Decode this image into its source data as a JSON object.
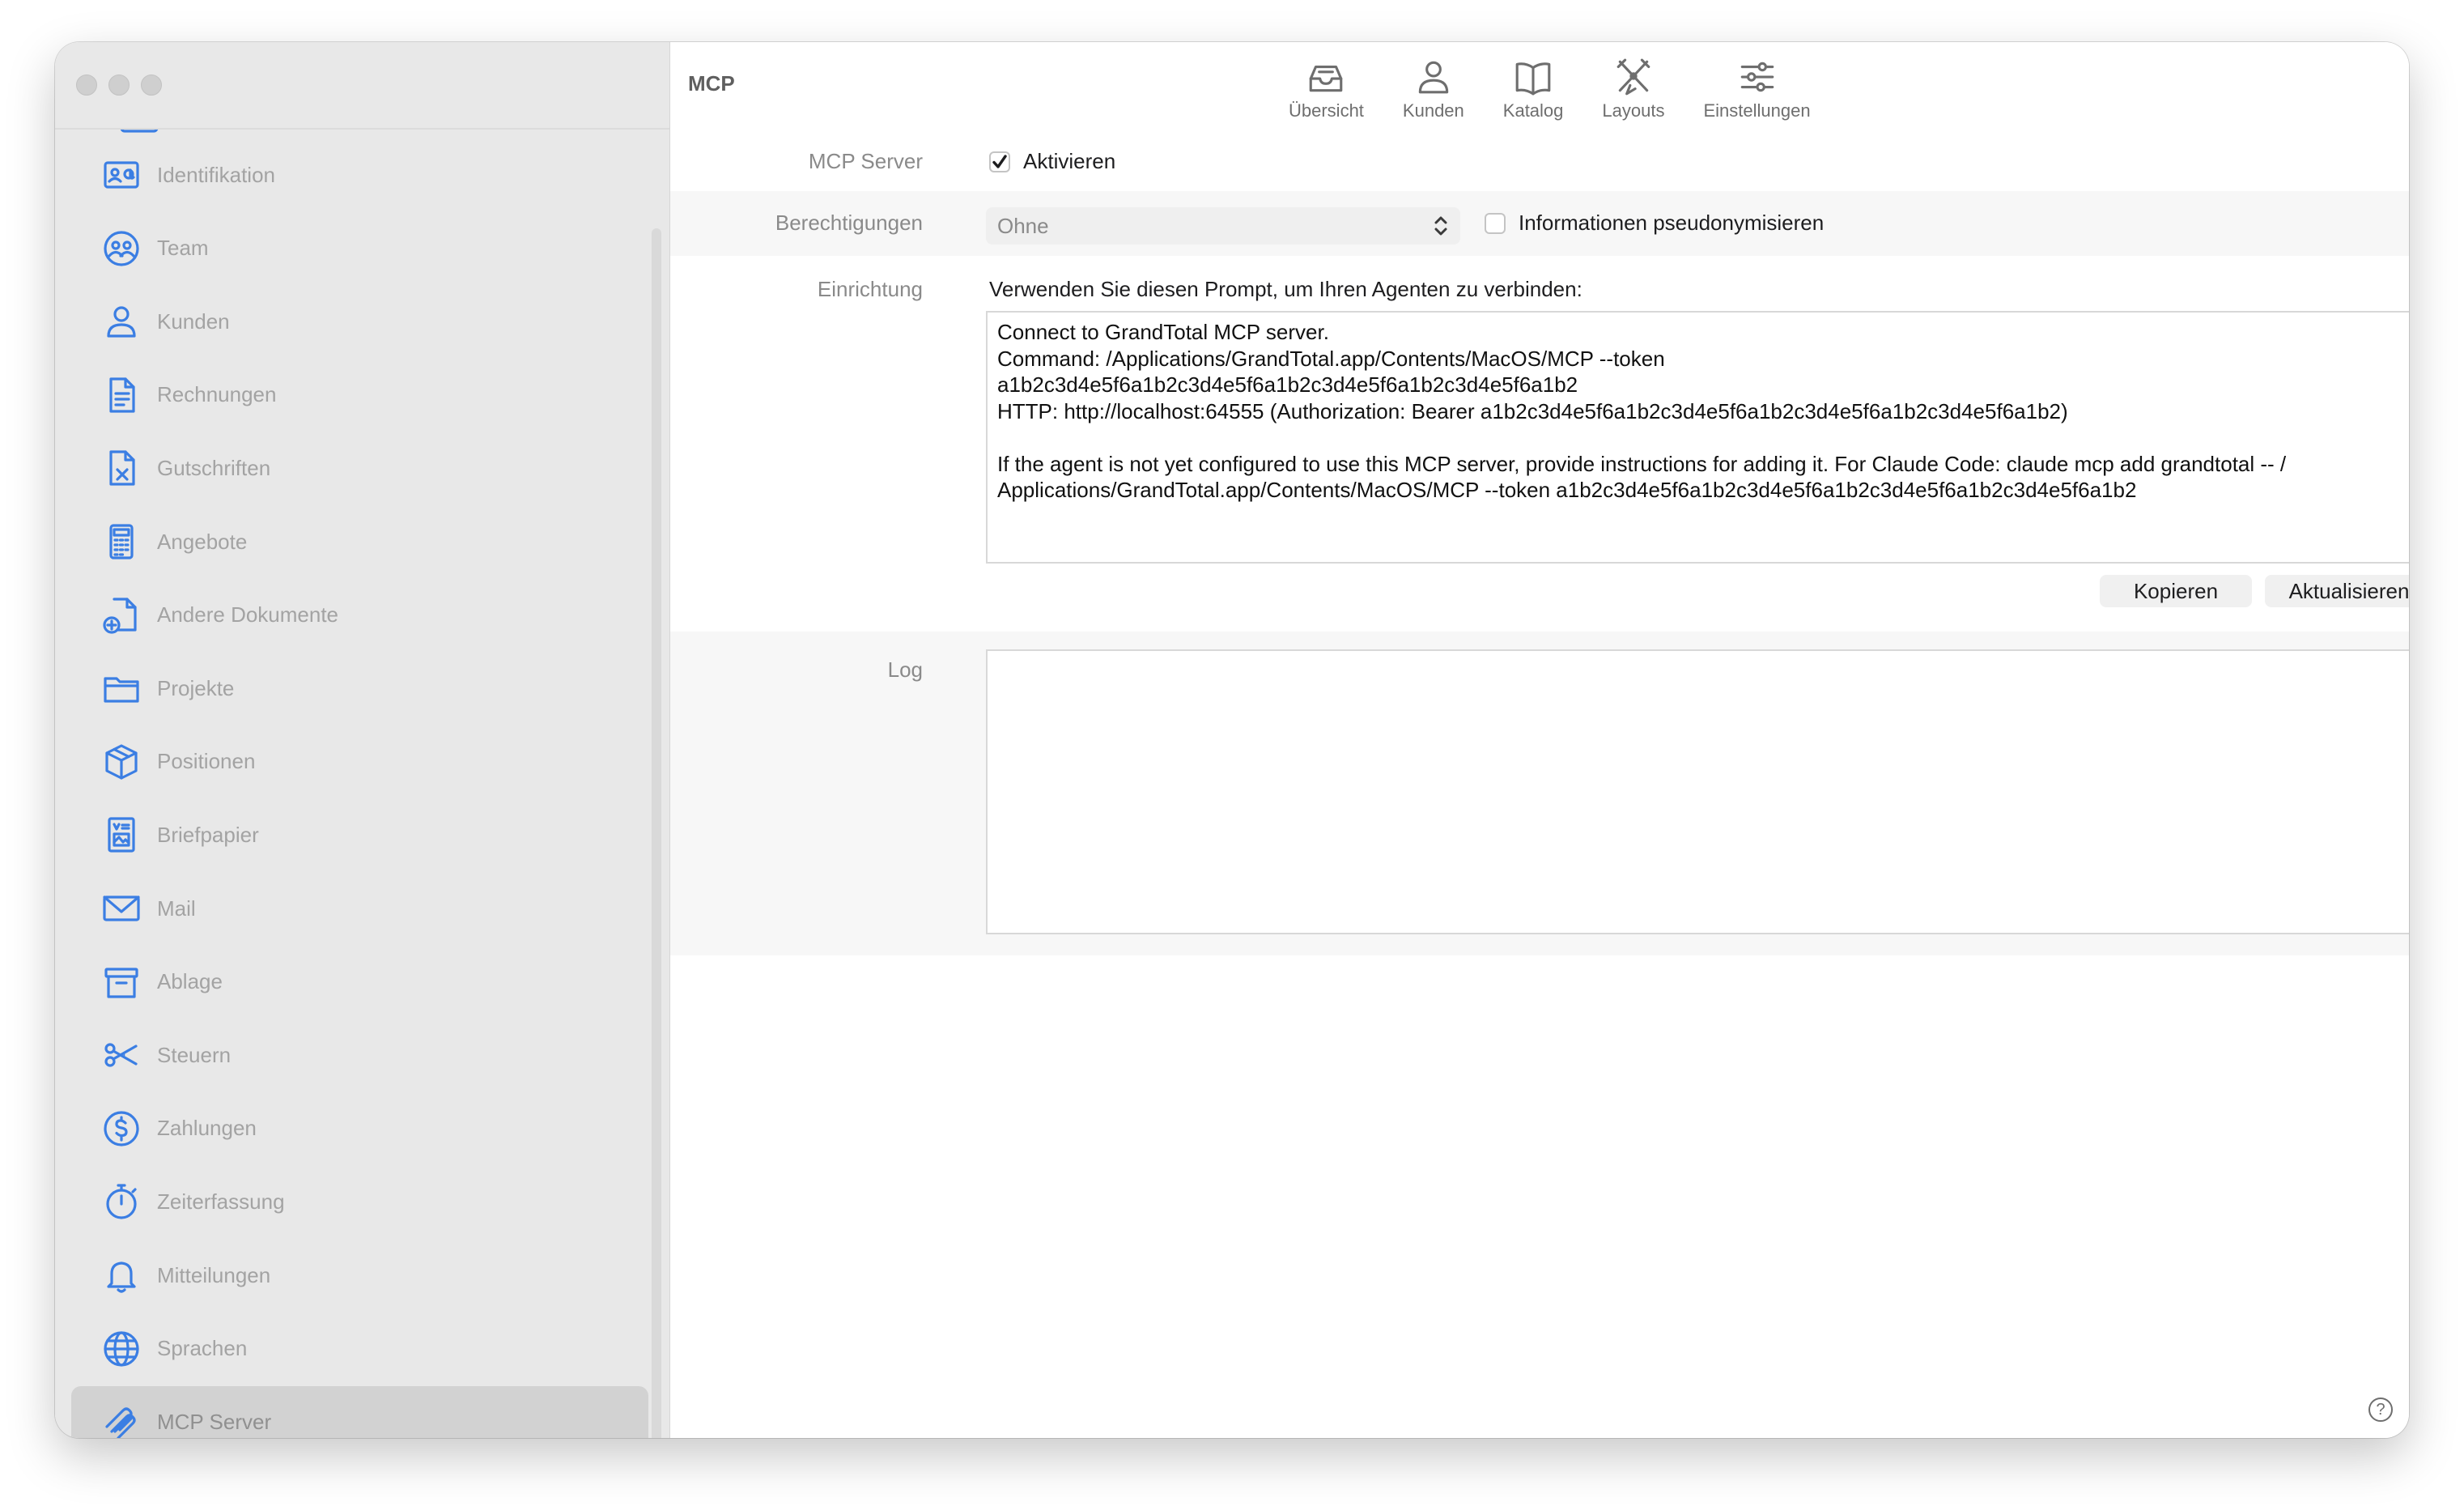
{
  "window": {
    "title": "MCP"
  },
  "sidebar": {
    "items": [
      {
        "label": "Identifikation",
        "icon": "id-card-icon"
      },
      {
        "label": "Team",
        "icon": "team-icon"
      },
      {
        "label": "Kunden",
        "icon": "person-icon"
      },
      {
        "label": "Rechnungen",
        "icon": "invoice-icon"
      },
      {
        "label": "Gutschriften",
        "icon": "credit-note-icon"
      },
      {
        "label": "Angebote",
        "icon": "calculator-icon"
      },
      {
        "label": "Andere Dokumente",
        "icon": "document-plus-icon"
      },
      {
        "label": "Projekte",
        "icon": "folder-icon"
      },
      {
        "label": "Positionen",
        "icon": "box-icon"
      },
      {
        "label": "Briefpapier",
        "icon": "letterhead-icon"
      },
      {
        "label": "Mail",
        "icon": "envelope-icon"
      },
      {
        "label": "Ablage",
        "icon": "archive-icon"
      },
      {
        "label": "Steuern",
        "icon": "scissors-icon"
      },
      {
        "label": "Zahlungen",
        "icon": "dollar-circle-icon"
      },
      {
        "label": "Zeiterfassung",
        "icon": "stopwatch-icon"
      },
      {
        "label": "Mitteilungen",
        "icon": "bell-icon"
      },
      {
        "label": "Sprachen",
        "icon": "globe-icon"
      },
      {
        "label": "MCP Server",
        "icon": "mcp-icon",
        "selected": true
      }
    ]
  },
  "toolbar": {
    "items": [
      {
        "label": "Übersicht",
        "icon": "tray-icon"
      },
      {
        "label": "Kunden",
        "icon": "person-icon"
      },
      {
        "label": "Katalog",
        "icon": "book-icon"
      },
      {
        "label": "Layouts",
        "icon": "layouts-icon"
      },
      {
        "label": "Einstellungen",
        "icon": "sliders-icon"
      }
    ]
  },
  "mcp_server": {
    "label": "MCP Server",
    "checkbox_label": "Aktivieren",
    "checked": true
  },
  "permissions": {
    "label": "Berechtigungen",
    "selected": "Ohne",
    "pseudonymize_label": "Informationen pseudonymisieren",
    "pseudonymize_checked": false
  },
  "setup": {
    "label": "Einrichtung",
    "intro": "Verwenden Sie diesen Prompt, um Ihren Agenten zu verbinden:",
    "prompt_lines": [
      "Connect to GrandTotal MCP server.",
      "Command: /Applications/GrandTotal.app/Contents/MacOS/MCP --token",
      "a1b2c3d4e5f6a1b2c3d4e5f6a1b2c3d4e5f6a1b2c3d4e5f6a1b2",
      "HTTP: http://localhost:64555 (Authorization: Bearer a1b2c3d4e5f6a1b2c3d4e5f6a1b2c3d4e5f6a1b2c3d4e5f6a1b2)",
      "",
      "If the agent is not yet configured to use this MCP server, provide instructions for adding it. For Claude Code: claude mcp add grandtotal -- /",
      "Applications/GrandTotal.app/Contents/MacOS/MCP --token a1b2c3d4e5f6a1b2c3d4e5f6a1b2c3d4e5f6a1b2c3d4e5f6a1b2"
    ],
    "copy_button": "Kopieren",
    "refresh_button": "Aktualisieren"
  },
  "log": {
    "label": "Log",
    "content": ""
  },
  "help": {
    "icon": "help-icon",
    "glyph": "?"
  },
  "colors": {
    "accent": "#3b7ee3",
    "sidebar_bg": "#e8e8e8",
    "selected_bg": "#d2d2d2"
  }
}
